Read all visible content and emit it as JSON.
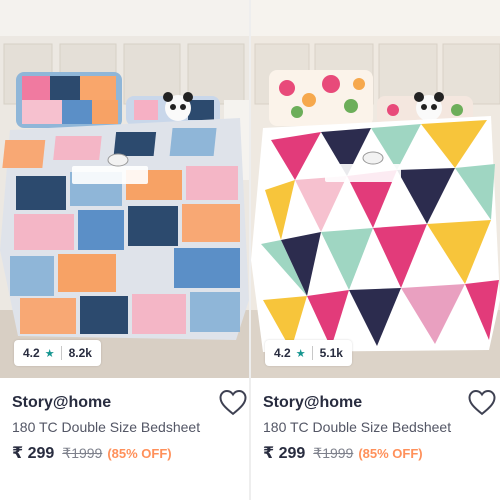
{
  "products": [
    {
      "rating": "4.2",
      "rating_star": "★",
      "rating_count": "8.2k",
      "brand": "Story@home",
      "title": "180 TC Double Size Bedsheet",
      "price": "₹ 299",
      "mrp": "₹1999",
      "discount": "(85% OFF)"
    },
    {
      "rating": "4.2",
      "rating_star": "★",
      "rating_count": "5.1k",
      "brand": "Story@home",
      "title": "180 TC Double Size Bedsheet",
      "price": "₹ 299",
      "mrp": "₹1999",
      "discount": "(85% OFF)"
    }
  ],
  "colors": {
    "rating_star": "#14958f",
    "discount": "#ff905a",
    "brand_text": "#282c3f"
  },
  "icons": [
    "star-icon",
    "wishlist-heart-icon"
  ]
}
